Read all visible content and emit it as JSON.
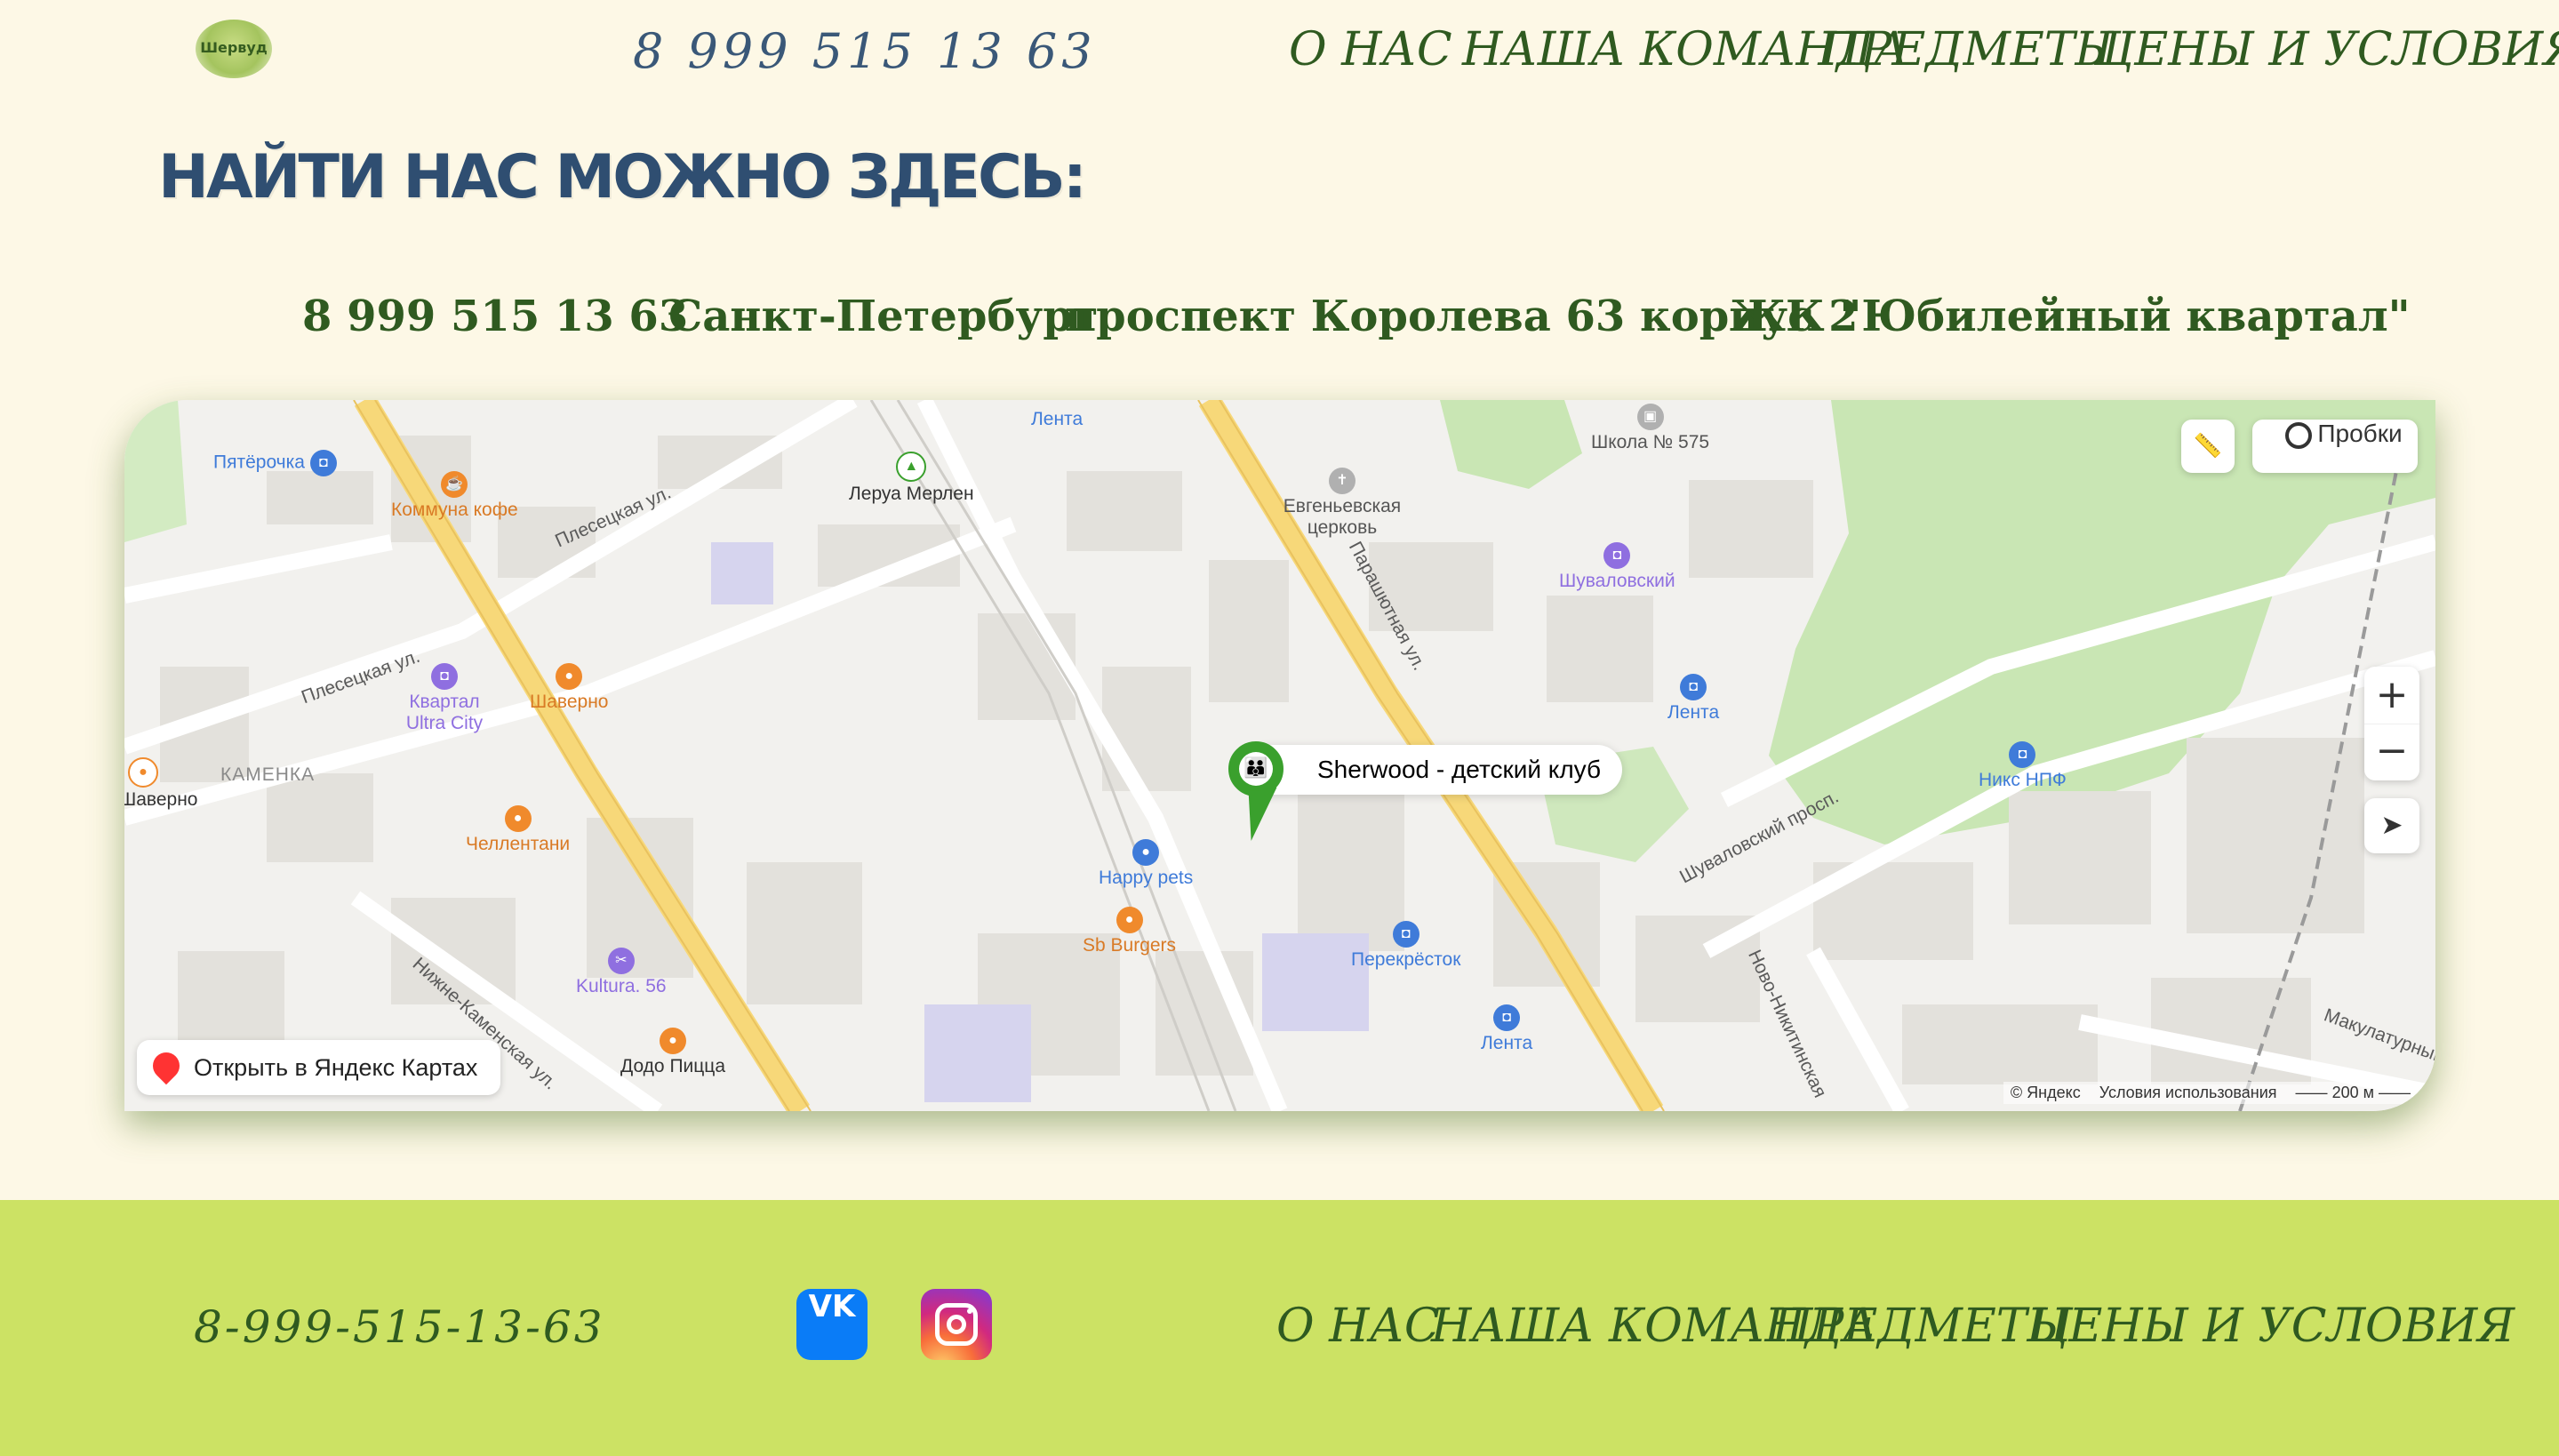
{
  "header": {
    "logo_text": "Шервуд",
    "phone": "8 999 515 13 63",
    "nav": [
      "О НАС",
      "НАША КОМАНДА",
      "ПРЕДМЕТЫ",
      "ЦЕНЫ И УСЛОВИЯ"
    ]
  },
  "section": {
    "title": "НАЙТИ НАС МОЖНО ЗДЕСЬ:",
    "contacts": [
      "8 999 515 13 63",
      "Санкт-Петербург",
      "проспект Королева 63 корпус 2",
      "ЖК \"Юбилейный квартал\""
    ]
  },
  "map": {
    "place_name": "Sherwood - детский клуб",
    "traffic_label": "Пробки",
    "zoom_in": "+",
    "zoom_out": "−",
    "open_label": "Открыть в Яндекс Картах",
    "copyright": "© Яндекс",
    "terms": "Условия использования",
    "scale": "200 м",
    "streets": [
      "Плесецкая ул.",
      "Плесецкая ул.",
      "Парашютная ул.",
      "Шуваловский просп.",
      "Ново-Никитинская",
      "Нижне-Каменская ул.",
      "Макулатурный пр.",
      "КАМЕНКА"
    ],
    "pois": [
      {
        "name": "Пятёрочка",
        "color": "#3f7bd9"
      },
      {
        "name": "Коммуна кофе",
        "color": "#f08a2c"
      },
      {
        "name": "Леруа Мерлен",
        "color": "#3aa02d"
      },
      {
        "name": "Лента",
        "color": "#3f7bd9"
      },
      {
        "name": "Евгеньевская церковь",
        "color": "#8a8a8a"
      },
      {
        "name": "Школа № 575",
        "color": "#8a8a8a"
      },
      {
        "name": "Шуваловский",
        "color": "#8f6fe0"
      },
      {
        "name": "Лента",
        "color": "#3f7bd9"
      },
      {
        "name": "Квартал Ultra City",
        "color": "#8f6fe0"
      },
      {
        "name": "Шаверно",
        "color": "#f08a2c"
      },
      {
        "name": "Шаверно",
        "color": "#f08a2c"
      },
      {
        "name": "Челлентани",
        "color": "#f08a2c"
      },
      {
        "name": "Happy pets",
        "color": "#3f7bd9"
      },
      {
        "name": "Sb Burgers",
        "color": "#f08a2c"
      },
      {
        "name": "Никс НПФ",
        "color": "#3f7bd9"
      },
      {
        "name": "Перекрёсток",
        "color": "#3f7bd9"
      },
      {
        "name": "Kultura. 56",
        "color": "#8f6fe0"
      },
      {
        "name": "Додо Пицца",
        "color": "#f08a2c"
      },
      {
        "name": "Лента",
        "color": "#3f7bd9"
      }
    ]
  },
  "footer": {
    "phone": "8-999-515-13-63",
    "vk_label": "VK",
    "nav": [
      "О НАС",
      "НАША КОМАНДА",
      "ПРЕДМЕТЫ",
      "ЦЕНЫ И УСЛОВИЯ"
    ]
  }
}
